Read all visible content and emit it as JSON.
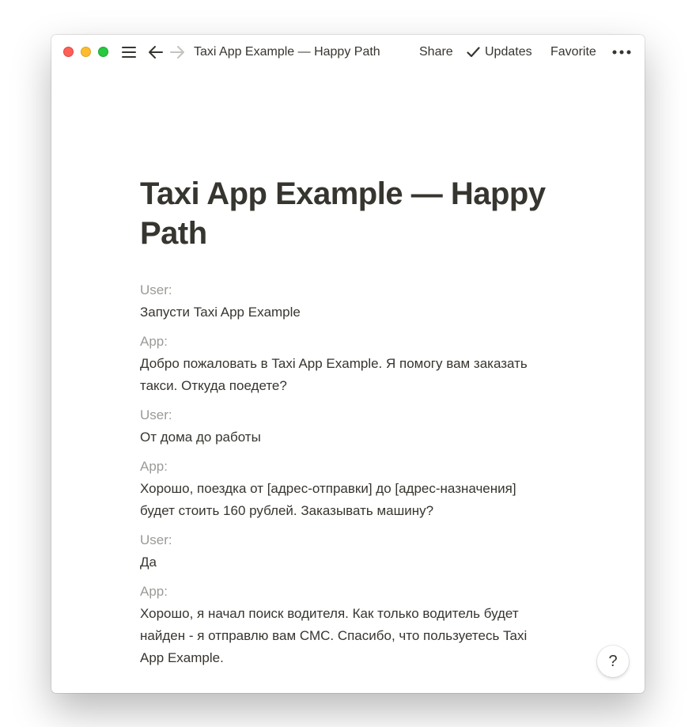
{
  "window": {
    "breadcrumb": "Taxi App Example — Happy Path",
    "actions": {
      "share": "Share",
      "updates": "Updates",
      "favorite": "Favorite"
    }
  },
  "icons": {
    "menu": "hamburger-icon",
    "back": "arrow-left-icon",
    "forward": "arrow-right-icon",
    "updates": "checkmark-icon",
    "more": "ellipsis-icon",
    "help": "question-icon"
  },
  "colors": {
    "text": "#37352f",
    "muted": "#9b9a97",
    "close": "#fe5f57",
    "minimize": "#febc2e",
    "zoom": "#28c840"
  },
  "page": {
    "title": "Taxi App Example — Happy Path",
    "dialogue": [
      {
        "speaker": "User:",
        "text": "Запусти Taxi App Example"
      },
      {
        "speaker": "App:",
        "text": "Добро пожаловать в Taxi App Example. Я помогу вам заказать такси. Откуда поедете?"
      },
      {
        "speaker": "User:",
        "text": "От дома до работы"
      },
      {
        "speaker": "App:",
        "text": "Хорошо, поездка от [адрес-отправки] до [адрес-назначения] будет стоить 160 рублей. Заказывать машину?"
      },
      {
        "speaker": "User:",
        "text": "Да"
      },
      {
        "speaker": "App:",
        "text": "Хорошо, я начал поиск водителя. Как только водитель будет найден - я отправлю вам СМС. Спасибо, что пользуетесь Taxi App Example."
      }
    ]
  },
  "help": {
    "label": "?"
  }
}
